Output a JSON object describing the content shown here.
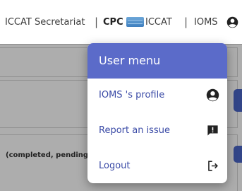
{
  "header": {
    "org_name": "ICCAT Secretariat",
    "separator": "|",
    "cpc_label": "CPC",
    "cpc_value": "ICCAT",
    "user_name": "IOMS",
    "account_icon": "account-circle-icon",
    "flag_icon": "flag-icon"
  },
  "background": {
    "text_snippet": "(completed, pending"
  },
  "user_menu": {
    "title": "User menu",
    "header_color": "#5b6bc9",
    "items": [
      {
        "label": "IOMS 's profile",
        "icon": "account-circle-icon"
      },
      {
        "label": "Report an issue",
        "icon": "report-icon"
      },
      {
        "label": "Logout",
        "icon": "logout-icon"
      }
    ]
  }
}
